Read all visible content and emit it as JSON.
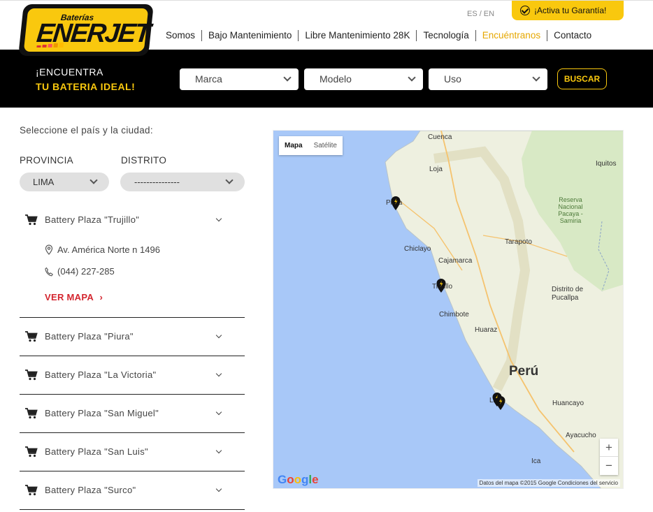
{
  "brand": {
    "small": "Baterías",
    "big": "ENERJET"
  },
  "lang": {
    "es": "ES",
    "sep": "/",
    "en": "EN"
  },
  "warranty_label": "¡Activa tu Garantía!",
  "nav": [
    "Somos",
    "Bajo Mantenimiento",
    "Libre Mantenimiento 28K",
    "Tecnología",
    "Encuéntranos",
    "Contacto"
  ],
  "nav_active": "Encuéntranos",
  "search": {
    "title_line1": "¡ENCUENTRA",
    "title_line2": "TU BATERIA IDEAL!",
    "brand_placeholder": "Marca",
    "model_placeholder": "Modelo",
    "use_placeholder": "Uso",
    "button": "BUSCAR"
  },
  "finder": {
    "instruction": "Seleccione el país y la ciudad:",
    "provincia_label": "PROVINCIA",
    "provincia_value": "LIMA",
    "distrito_label": "DISTRITO",
    "distrito_value": "---------------"
  },
  "stores": [
    {
      "name": "Battery Plaza \"Trujillo\"",
      "address": "Av. América Norte n 1496",
      "phone": "(044) 227-285",
      "link": "VER MAPA",
      "link_arrow": "›"
    },
    {
      "name": "Battery Plaza \"Piura\""
    },
    {
      "name": "Battery Plaza \"La Victoria\""
    },
    {
      "name": "Battery Plaza \"San Miguel\""
    },
    {
      "name": "Battery Plaza \"San Luis\""
    },
    {
      "name": "Battery Plaza \"Surco\""
    }
  ],
  "map": {
    "tab_map": "Mapa",
    "tab_satellite": "Satélite",
    "zoom_in": "+",
    "zoom_out": "−",
    "logo": "Google",
    "attribution": "Datos del mapa ©2015 Google   Condiciones del servicio",
    "cities": [
      "Cuenca",
      "Loja",
      "Iquitos",
      "Piura",
      "Reserva Nacional Pacaya - Samiria",
      "Tarapoto",
      "Chiclayo",
      "Cajamarca",
      "Trujillo",
      "Distrito de Pucallpa",
      "Chimbote",
      "Huaraz",
      "Perú",
      "Lima",
      "Huancayo",
      "Ayacucho",
      "Ica"
    ]
  },
  "colors": {
    "accent": "#f9c80e",
    "link_red": "#d4262f",
    "nav_active": "#e6a700",
    "sea": "#a8c8f8",
    "land": "#eef0e0"
  }
}
